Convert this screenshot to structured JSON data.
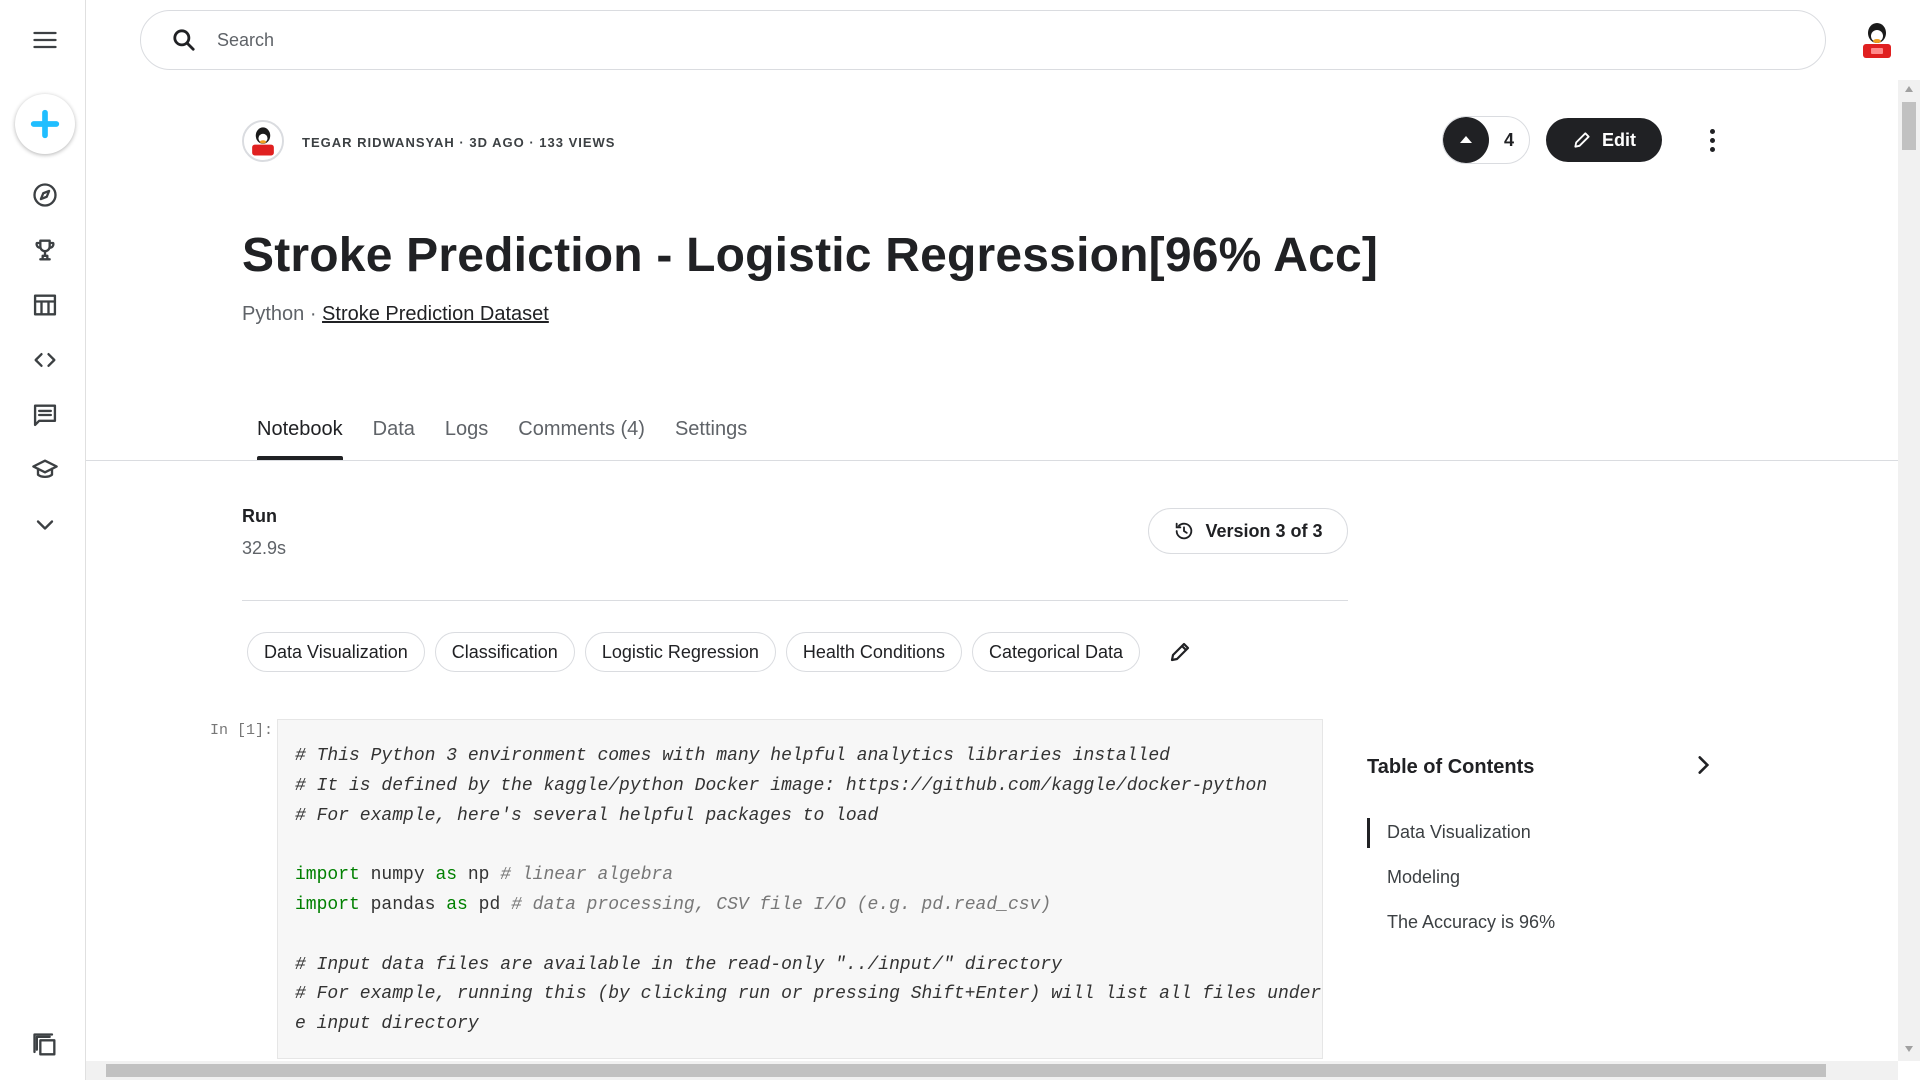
{
  "nav": {
    "items": [
      {
        "icon": "menu-icon"
      },
      {
        "icon": "plus-icon"
      },
      {
        "icon": "compass-icon"
      },
      {
        "icon": "trophy-icon"
      },
      {
        "icon": "table-icon"
      },
      {
        "icon": "code-icon"
      },
      {
        "icon": "comments-icon"
      },
      {
        "icon": "graduation-cap-icon"
      },
      {
        "icon": "chevron-down-icon"
      },
      {
        "icon": "copy-icon"
      }
    ]
  },
  "search": {
    "placeholder": "Search",
    "value": ""
  },
  "header": {
    "author": "Tegar Ridwansyah",
    "age": "3d ago",
    "views": "133 views",
    "upvote_count": "4",
    "edit_label": "Edit",
    "title": "Stroke Prediction - Logistic Regression[96% Acc]",
    "language": "Python",
    "dataset": "Stroke Prediction Dataset"
  },
  "tabs": [
    {
      "label": "Notebook",
      "active": true
    },
    {
      "label": "Data"
    },
    {
      "label": "Logs"
    },
    {
      "label": "Comments (4)"
    },
    {
      "label": "Settings"
    }
  ],
  "run": {
    "label": "Run",
    "value": "32.9s",
    "version": "Version 3 of 3"
  },
  "tags": [
    "Data Visualization",
    "Classification",
    "Logistic Regression",
    "Health Conditions",
    "Categorical Data"
  ],
  "code_cell": {
    "prompt": "In [1]:",
    "lines": [
      "# This Python 3 environment comes with many helpful analytics libraries installed",
      "# It is defined by the kaggle/python Docker image: https://github.com/kaggle/docker-python",
      "# For example, here's several helpful packages to load",
      "",
      "import numpy as np # linear algebra",
      "import pandas as pd # data processing, CSV file I/O (e.g. pd.read_csv)",
      "",
      "# Input data files are available in the read-only \"../input/\" directory",
      "# For example, running this (by clicking run or pressing Shift+Enter) will list all files under th",
      "e input directory"
    ]
  },
  "toc": {
    "title": "Table of Contents",
    "items": [
      "Data Visualization",
      "Modeling",
      "The Accuracy is 96%"
    ]
  },
  "colors": {
    "accent": "#20beff",
    "primary": "#202124",
    "keyword": "#008000"
  }
}
